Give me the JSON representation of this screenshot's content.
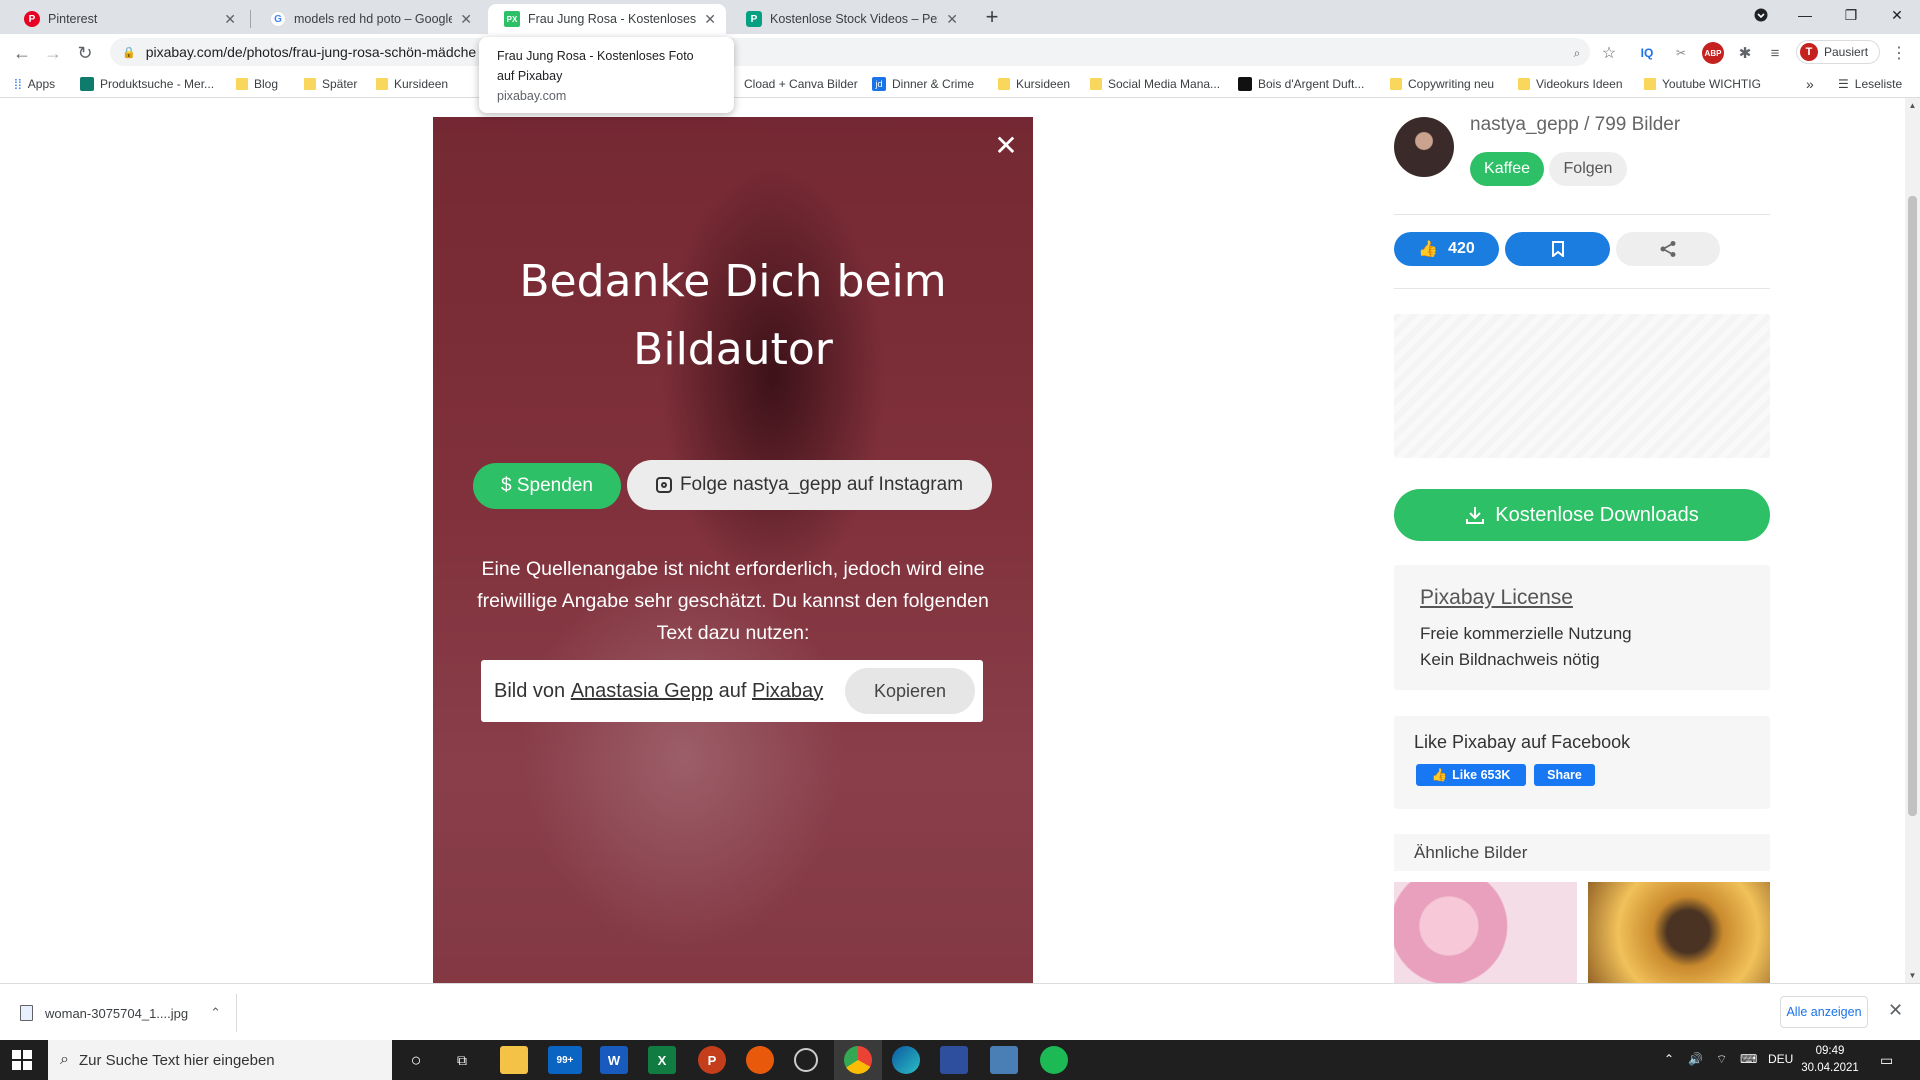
{
  "browser": {
    "tabs": [
      {
        "title": "Pinterest",
        "favicon": "P",
        "color": "#e60023"
      },
      {
        "title": "models red hd poto – Google Su",
        "favicon": "G",
        "color": "#4285f4"
      },
      {
        "title": "Frau Jung Rosa - Kostenloses Fo",
        "favicon": "PX",
        "color": "#2ec066"
      },
      {
        "title": "Kostenlose Stock Videos – Pexel",
        "favicon": "P",
        "color": "#05a081"
      }
    ],
    "url": "pixabay.com/de/photos/frau-jung-rosa-schön-mädche",
    "profile_status": "Pausiert",
    "profile_initial": "T",
    "tooltip": {
      "line1": "Frau Jung Rosa - Kostenloses Foto",
      "line2": "auf Pixabay",
      "domain": "pixabay.com"
    },
    "bookmarks": [
      {
        "label": "Apps"
      },
      {
        "label": "Produktsuche - Mer..."
      },
      {
        "label": "Blog"
      },
      {
        "label": "Später"
      },
      {
        "label": "Kursideen"
      },
      {
        "label": "Cload + Canva Bilder"
      },
      {
        "label": "Dinner & Crime"
      },
      {
        "label": "Kursideen"
      },
      {
        "label": "Social Media Mana..."
      },
      {
        "label": "Bois d'Argent Duft..."
      },
      {
        "label": "Copywriting neu"
      },
      {
        "label": "Videokurs Ideen"
      },
      {
        "label": "Youtube WICHTIG"
      }
    ],
    "more_bookmarks": "»",
    "reading_list": "Leseliste"
  },
  "modal": {
    "title_line1": "Bedanke Dich beim",
    "title_line2": "Bildautor",
    "donate_label": "$ Spenden",
    "instagram_label": "Folge nastya_gepp auf Instagram",
    "info_text": "Eine Quellenangabe ist nicht erforderlich, jedoch wird eine freiwillige Angabe sehr geschätzt. Du kannst den folgenden Text dazu nutzen:",
    "credit_prefix": "Bild von",
    "credit_author": "Anastasia Gepp",
    "credit_middle": "auf",
    "credit_site": "Pixabay",
    "copy_label": "Kopieren"
  },
  "sidebar": {
    "author": "nastya_gepp / 799 Bilder",
    "coffee_label": "Kaffee",
    "follow_label": "Folgen",
    "likes": "420",
    "download_label": "Kostenlose Downloads",
    "license_title": "Pixabay License",
    "license_line1": "Freie kommerzielle Nutzung",
    "license_line2": "Kein Bildnachweis nötig",
    "facebook_title": "Like Pixabay auf Facebook",
    "fb_like_label": "Like 653K",
    "fb_share_label": "Share",
    "similar_title": "Ähnliche Bilder"
  },
  "downloads": {
    "file": "woman-3075704_1....jpg",
    "show_all": "Alle anzeigen"
  },
  "taskbar": {
    "search_placeholder": "Zur Suche Text hier eingeben",
    "mail_badge": "99+",
    "language": "DEU",
    "time": "09:49",
    "date": "30.04.2021"
  },
  "colors": {
    "green": "#2ec066",
    "blue": "#1b7de0",
    "facebook": "#1877f2"
  }
}
